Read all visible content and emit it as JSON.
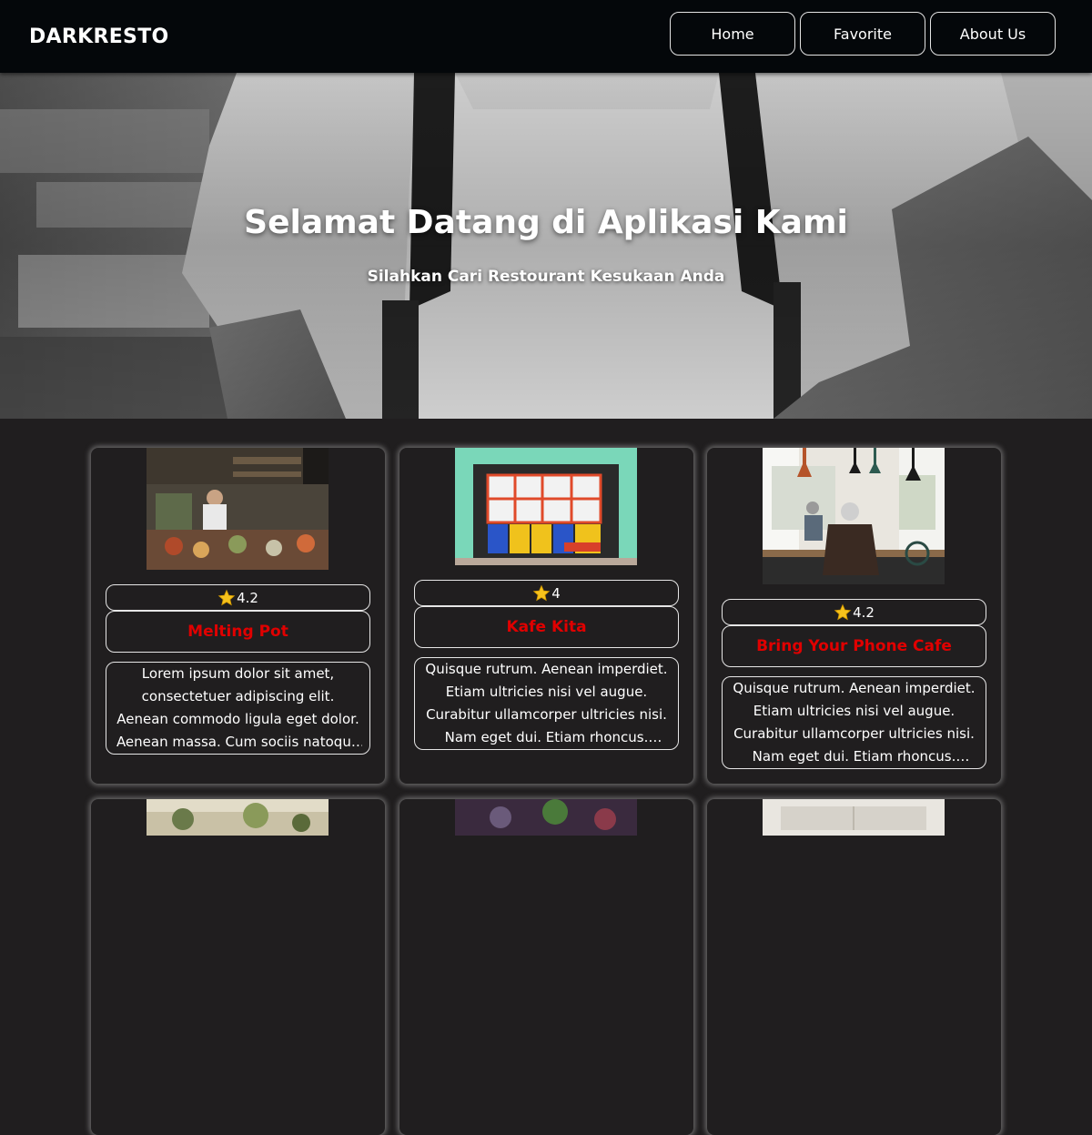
{
  "navbar": {
    "brand": "DARKRESTO",
    "links": [
      "Home",
      "Favorite",
      "About Us"
    ]
  },
  "hero": {
    "title": "Selamat Datang di Aplikasi Kami",
    "subtitle": "Silahkan Cari Restourant Kesukaan Anda"
  },
  "restaurants": [
    {
      "rating": "4.2",
      "name": "Melting Pot",
      "description": "Lorem ipsum dolor sit amet, consectetuer adipiscing elit. Aenean commodo ligula eget dolor. Aenean massa. Cum sociis natoque penatibus et magnis dis parturient montes"
    },
    {
      "rating": "4",
      "name": "Kafe Kita",
      "description": "Quisque rutrum. Aenean imperdiet. Etiam ultricies nisi vel augue. Curabitur ullamcorper ultricies nisi. Nam eget dui. Etiam rhoncus. Maecenas tempus"
    },
    {
      "rating": "4.2",
      "name": "Bring Your Phone Cafe",
      "description": "Quisque rutrum. Aenean imperdiet. Etiam ultricies nisi vel augue. Curabitur ullamcorper ultricies nisi. Nam eget dui. Etiam rhoncus. Maecenas tempus"
    }
  ],
  "colors": {
    "navbar_bg": "#04070a",
    "page_bg": "#201e1f",
    "restaurant_name": "#e00000",
    "border": "#e6e6e6"
  }
}
